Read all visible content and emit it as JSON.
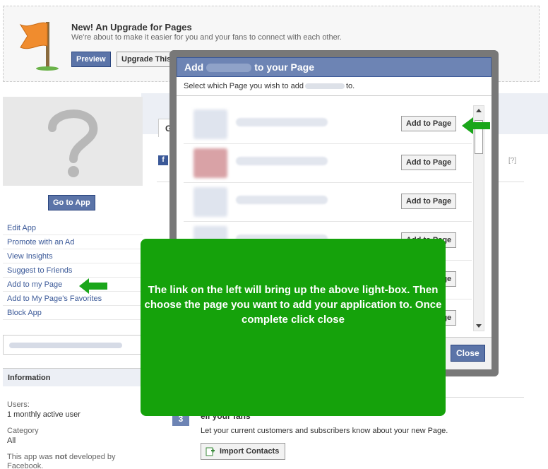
{
  "banner": {
    "title": "New! An Upgrade for Pages",
    "subtitle": "We're about to make it easier for you and your fans to connect with each other.",
    "preview_label": "Preview",
    "upgrade_label": "Upgrade This P"
  },
  "page": {
    "tab_label": "Ge",
    "help_label": "[?]",
    "fb_letter": "f"
  },
  "left": {
    "go_to_app_label": "Go to App",
    "links": [
      "Edit App",
      "Promote with an Ad",
      "View Insights",
      "Suggest to Friends",
      "Add to my Page",
      "Add to My Page's Favorites",
      "Block App"
    ],
    "info_heading": "Information",
    "users_label": "Users:",
    "users_value": "1 monthly active user",
    "category_label": "Category",
    "category_value": "All",
    "dev_note_pre": "This app was ",
    "dev_note_bold": "not",
    "dev_note_post": " developed by",
    "dev_note_line2": "Facebook."
  },
  "modal": {
    "title_pre": "Add",
    "title_post": "to your Page",
    "subtitle_pre": "Select which Page you wish to add",
    "subtitle_post": "to.",
    "add_label": "Add to Page",
    "close_label": "Close"
  },
  "step": {
    "number": "3",
    "title": "ell your fans",
    "description": "Let your current customers and subscribers know about your new Page.",
    "import_label": "Import Contacts"
  },
  "callout": {
    "text": "The link on the left will bring up the above light-box. Then choose the page you want to add your application to. Once complete click close"
  },
  "colors": {
    "callout_green": "#15a20b",
    "arrow_green": "#1aa61a",
    "fb_blue": "#3b5998"
  }
}
